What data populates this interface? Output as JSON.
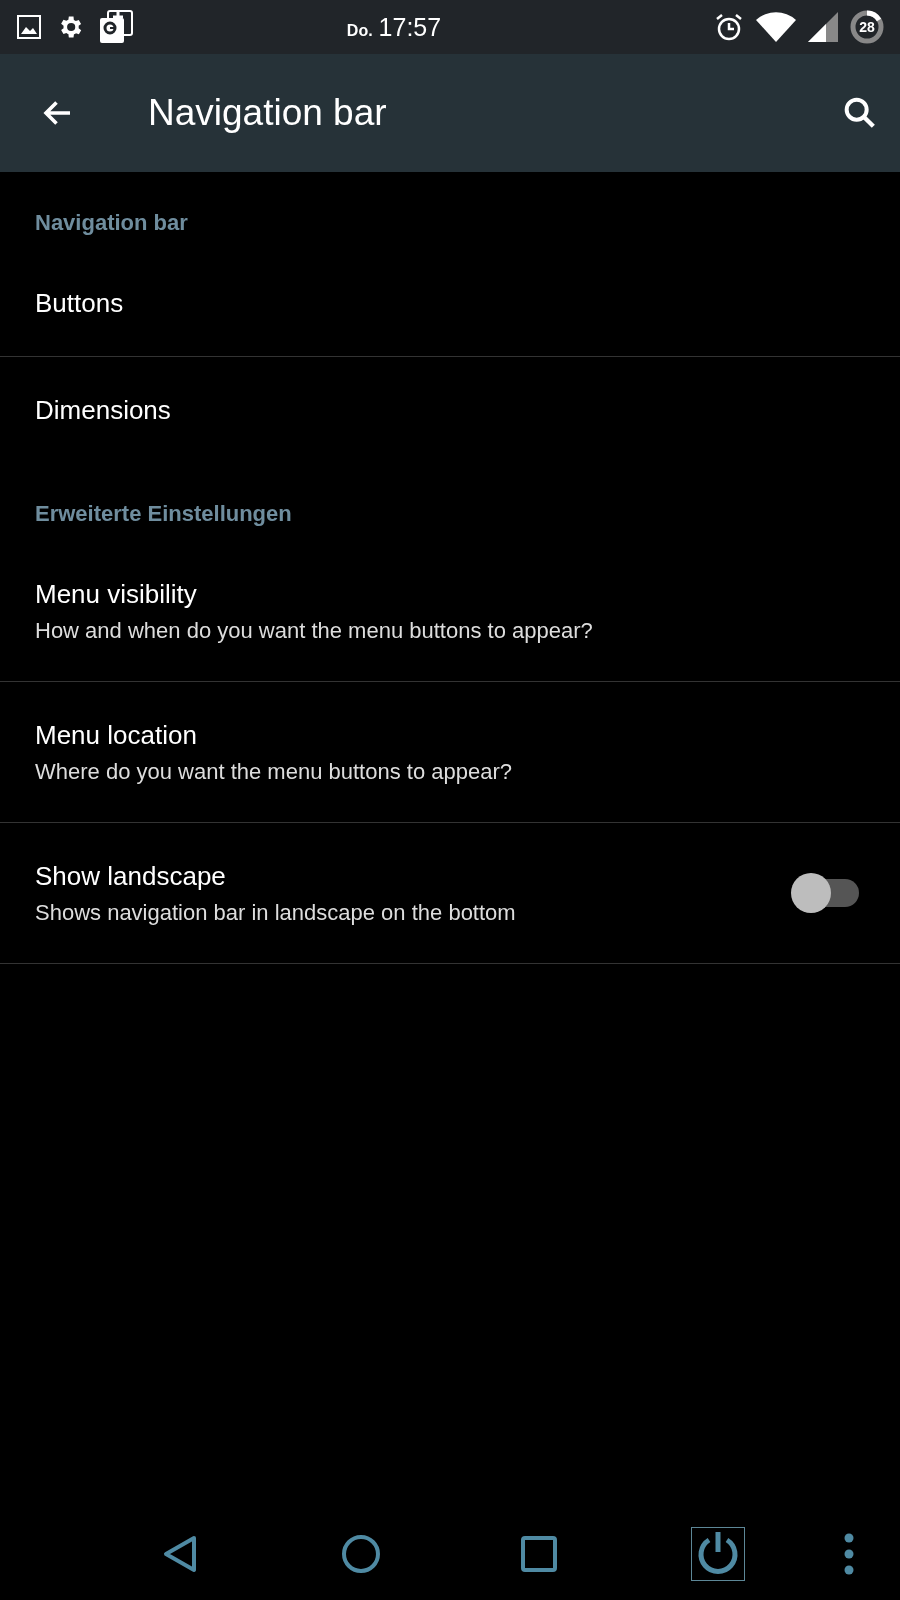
{
  "status_bar": {
    "day": "Do.",
    "time": "17:57",
    "battery": "28"
  },
  "toolbar": {
    "title": "Navigation bar"
  },
  "sections": [
    {
      "header": "Navigation bar",
      "items": [
        {
          "kind": "plain",
          "title": "Buttons",
          "divider": true
        },
        {
          "kind": "plain",
          "title": "Dimensions",
          "divider": false
        }
      ]
    },
    {
      "header": "Erweiterte Einstellungen",
      "items": [
        {
          "kind": "plain",
          "title": "Menu visibility",
          "summary": "How and when do you want the menu buttons to appear?",
          "divider": true
        },
        {
          "kind": "plain",
          "title": "Menu location",
          "summary": "Where do you want the menu buttons to appear?",
          "divider": true
        },
        {
          "kind": "switch",
          "title": "Show landscape",
          "summary": "Shows navigation bar in landscape on the bottom",
          "on": false,
          "divider": true
        }
      ]
    }
  ],
  "nav_bar": {
    "power_selected": true
  }
}
